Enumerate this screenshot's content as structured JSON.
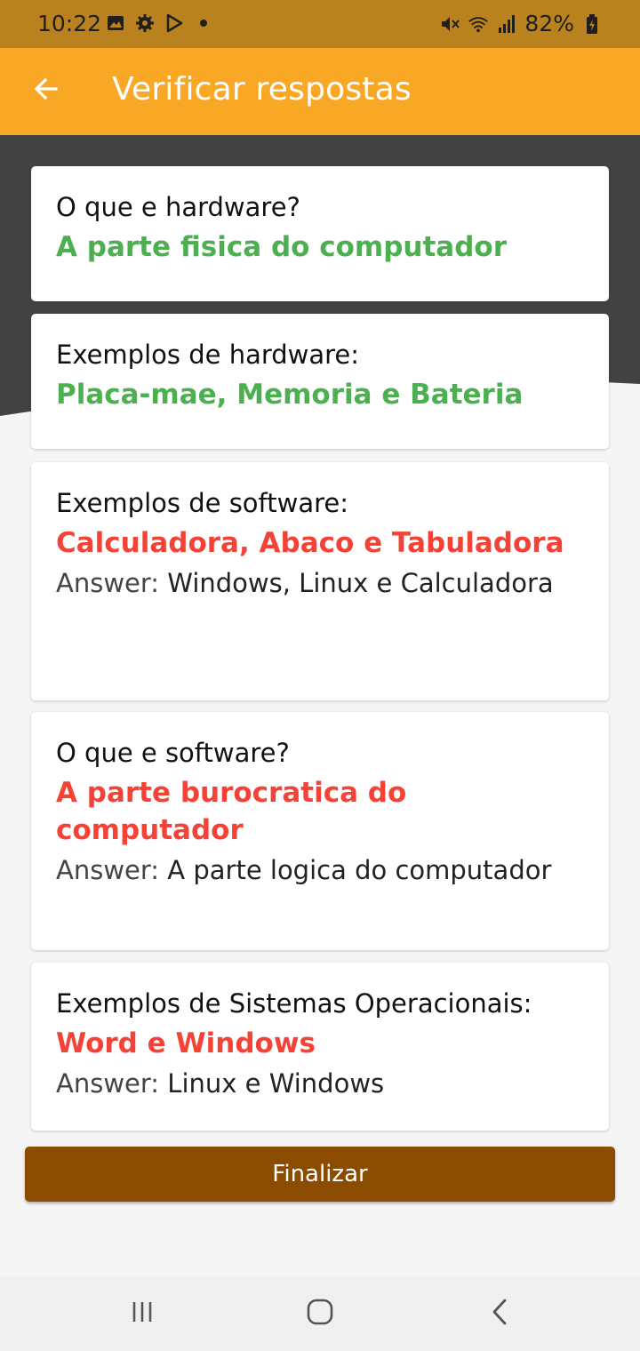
{
  "status_bar": {
    "time": "10:22",
    "battery": "82%",
    "icons_left": [
      "image-icon",
      "gear-icon",
      "play-store-icon",
      "dot-icon"
    ],
    "icons_right": [
      "mute-icon",
      "wifi-icon",
      "signal-icon",
      "battery-icon"
    ]
  },
  "app_bar": {
    "title": "Verificar respostas",
    "back_icon": "arrow-left-icon"
  },
  "colors": {
    "status_bar": "#b9821f",
    "app_bar": "#f9a826",
    "dark_background": "#424242",
    "correct": "#4caf50",
    "incorrect": "#f44336",
    "button": "#8b4c00"
  },
  "answer_label": "Answer:",
  "cards": [
    {
      "question": "O que e hardware?",
      "given": "A parte fisica do computador",
      "correct": true
    },
    {
      "question": "Exemplos de hardware:",
      "given": "Placa-mae, Memoria e Bateria",
      "correct": true
    },
    {
      "question": "Exemplos de software:",
      "given": "Calculadora, Abaco e Tabuladora",
      "correct": false,
      "answer": "Windows, Linux e Calculadora"
    },
    {
      "question": "O que e software?",
      "given": "A parte burocratica do computador",
      "correct": false,
      "answer": "A parte logica do computador"
    },
    {
      "question": "Exemplos de Sistemas Operacionais:",
      "given": "Word e Windows",
      "correct": false,
      "answer": "Linux e Windows"
    }
  ],
  "finish_button": "Finalizar",
  "nav_bar": {
    "icons": [
      "recent-apps-icon",
      "home-icon",
      "back-icon"
    ]
  }
}
